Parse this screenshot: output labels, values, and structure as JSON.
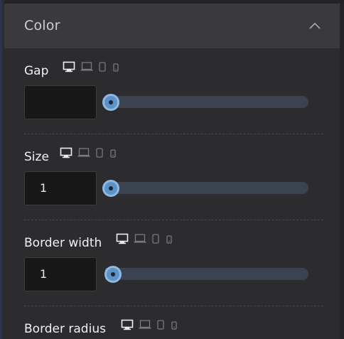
{
  "panel": {
    "title": "Color"
  },
  "controls": [
    {
      "label": "Gap",
      "value": "",
      "slider_fraction": 0.0
    },
    {
      "label": "Size",
      "value": "1",
      "slider_fraction": 0.0
    },
    {
      "label": "Border width",
      "value": "1",
      "slider_fraction": 0.01
    },
    {
      "label": "Border radius",
      "value": "",
      "slider_fraction": 0.0
    }
  ],
  "device_icons": [
    "desktop-icon",
    "laptop-icon",
    "tablet-icon",
    "mobile-icon"
  ],
  "colors": {
    "accent": "#5c92c8",
    "panel_bg": "#2c2c2e",
    "header_bg": "#3a3a3d"
  }
}
